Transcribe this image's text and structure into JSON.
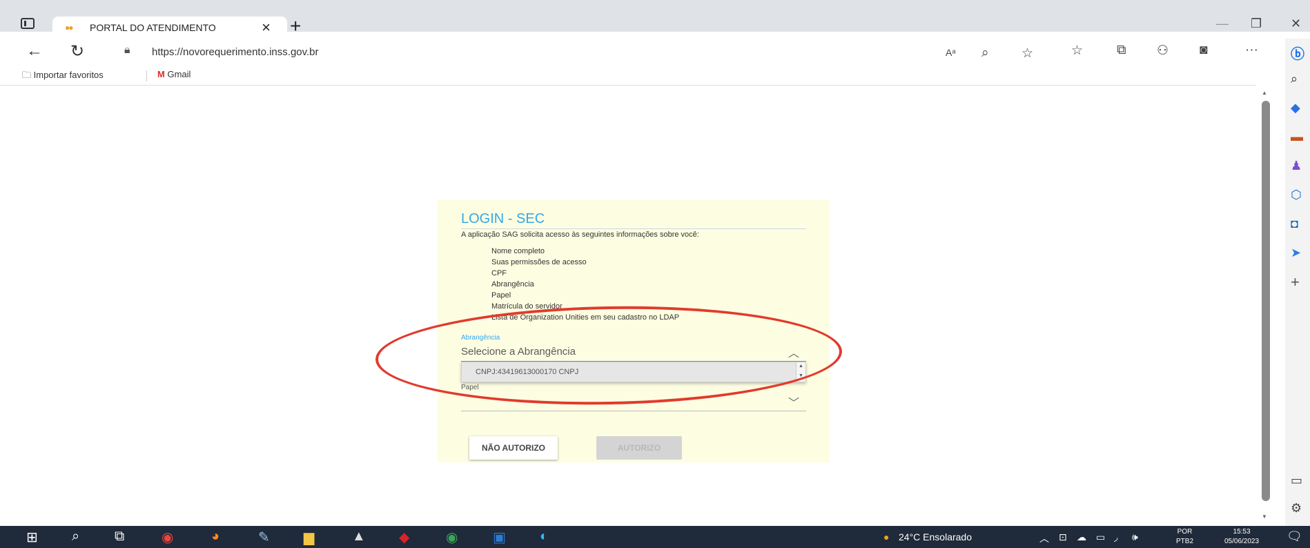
{
  "browser": {
    "tab_title": "PORTAL DO ATENDIMENTO",
    "tab_close": "×",
    "new_tab": "+",
    "url": "https://novorequerimento.inss.gov.br",
    "read_aloud": "Aᵃ",
    "more": "···",
    "favorites": [
      {
        "label": "Importar favoritos",
        "icon": "folder-icon"
      },
      {
        "label": "Gmail",
        "icon": "gmail-icon"
      }
    ]
  },
  "login": {
    "title": "LOGIN - SEC",
    "intro": "A aplicação SAG solicita acesso às seguintes informações sobre você:",
    "permissions": [
      "Nome completo",
      "Suas permissões de acesso",
      "CPF",
      "Abrangência",
      "Papel",
      "Matrícula do servidor",
      "Lista de Organization Unities em seu cadastro no LDAP"
    ],
    "abrangencia_label": "Abrangência",
    "abrangencia_placeholder": "Selecione a Abrangência",
    "abrangencia_option": "CNPJ:43419613000170 CNPJ",
    "papel_label": "Papel",
    "papel_value": "",
    "deny_button": "NÃO AUTORIZO",
    "allow_button": "AUTORIZO"
  },
  "taskbar": {
    "weather": "24°C  Ensolarado",
    "lang_line1": "POR",
    "lang_line2": "PTB2",
    "time": "15:53",
    "date": "05/06/2023"
  },
  "colors": {
    "accent": "#35a7e8",
    "panel_bg": "#fdfde2",
    "annotation": "#e03b2c",
    "taskbar": "#1f2a3a"
  }
}
